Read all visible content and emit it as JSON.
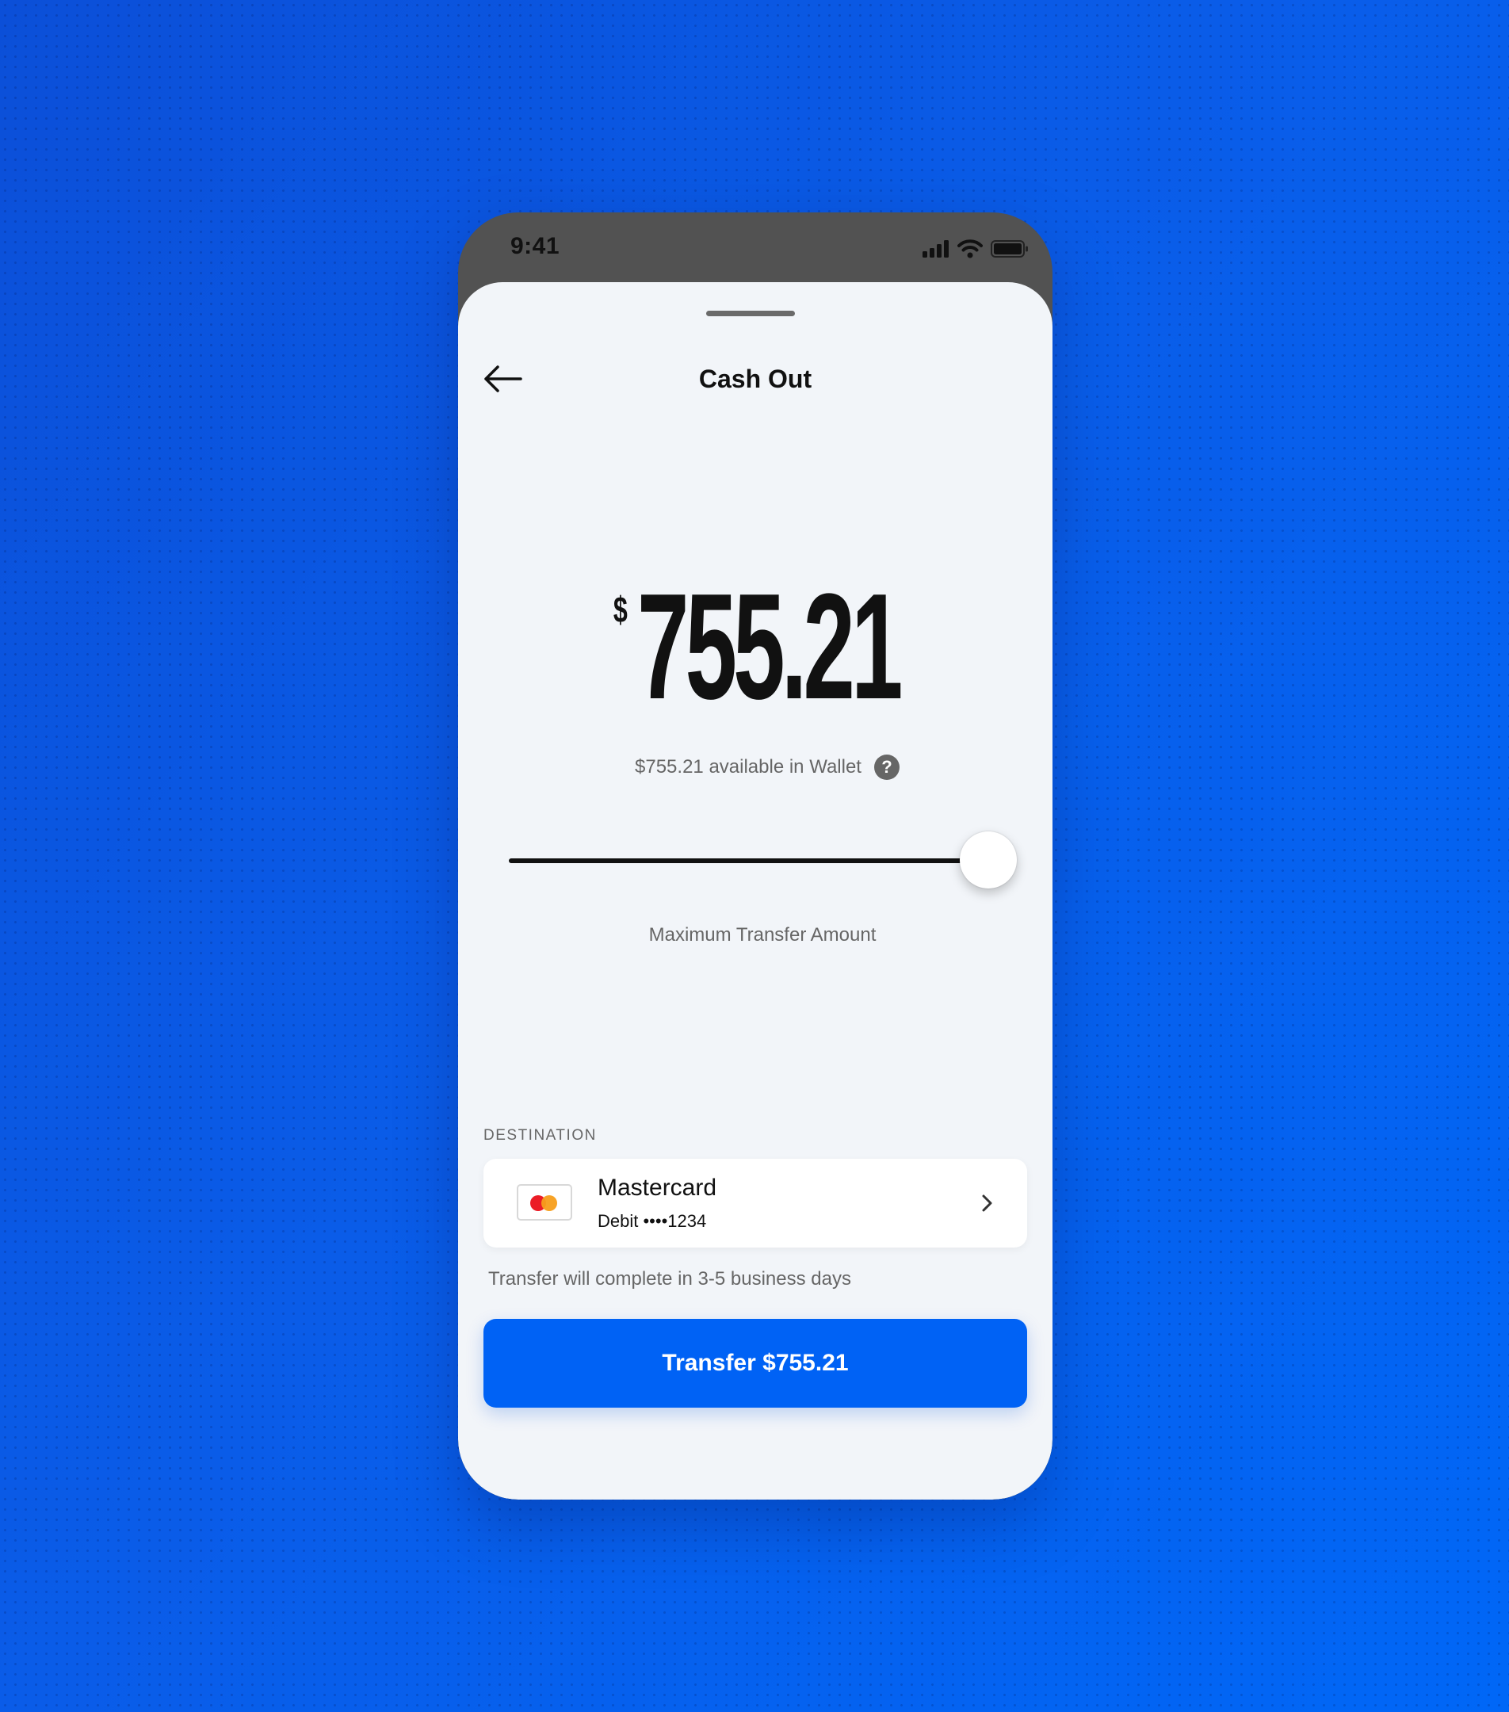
{
  "status_bar": {
    "time": "9:41",
    "icons": [
      "cellular-signal-icon",
      "wifi-icon",
      "battery-icon"
    ]
  },
  "header": {
    "back_icon": "arrow-left-icon",
    "title": "Cash Out"
  },
  "amount": {
    "currency_symbol": "$",
    "value": "755.21",
    "available_text": "$755.21 available in Wallet",
    "help_label": "?"
  },
  "slider": {
    "level_fraction": 0.975,
    "caption": "Maximum Transfer Amount"
  },
  "destination": {
    "section_label": "DESTINATION",
    "card_name": "Mastercard",
    "card_number": "Debit ••••1234",
    "card_logo": "mastercard-logo"
  },
  "note": "Transfer will complete in 3-5 business days",
  "action": {
    "button_label": "Transfer $755.21"
  },
  "colors": {
    "background": "#0a5ce8",
    "primary_button": "#0062f5",
    "sheet": "#f2f5f9",
    "mastercard_red": "#eb1c26",
    "mastercard_orange": "#f79e1b"
  }
}
